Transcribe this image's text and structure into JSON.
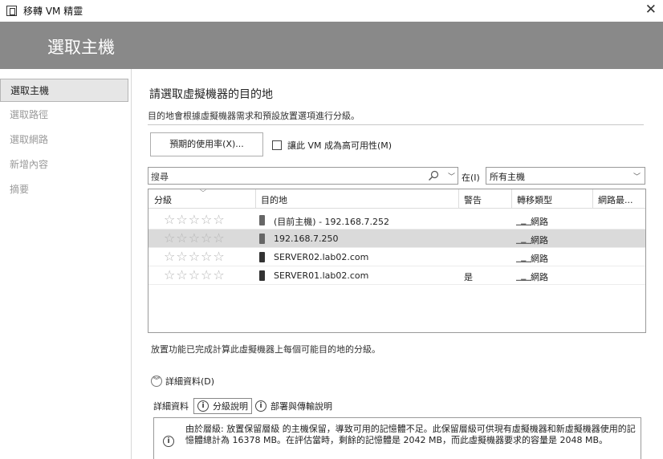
{
  "window": {
    "title": "移轉 VM 精靈",
    "close_glyph": "✕"
  },
  "banner": {
    "heading": "選取主機"
  },
  "sidebar": {
    "items": [
      {
        "label": "選取主機",
        "active": true
      },
      {
        "label": "選取路徑",
        "active": false
      },
      {
        "label": "選取網路",
        "active": false
      },
      {
        "label": "新增內容",
        "active": false
      },
      {
        "label": "摘要",
        "active": false
      }
    ]
  },
  "section": {
    "title": "請選取虛擬機器的目的地",
    "description": "目的地會根據虛擬機器需求和預設放置選項進行分級。"
  },
  "toolbar": {
    "usage_button": "預期的使用率(X)...",
    "ha_checkbox_label": "讓此 VM 成為高可用性(M)",
    "ha_checked": false
  },
  "search": {
    "placeholder": "搜尋",
    "in_label": "在(I)",
    "scope_value": "所有主機"
  },
  "grid": {
    "columns": [
      "分級",
      "目的地",
      "警告",
      "轉移類型",
      "網路最..."
    ],
    "rows": [
      {
        "stars": "☆☆☆☆☆",
        "destination": "(目前主機) - 192.168.7.252",
        "warning": "",
        "transfer": "網路",
        "network": "",
        "selected": false
      },
      {
        "stars": "☆☆☆☆☆",
        "destination": "192.168.7.250",
        "warning": "",
        "transfer": "網路",
        "network": "",
        "selected": true
      },
      {
        "stars": "☆☆☆☆☆",
        "destination": "SERVER02.lab02.com",
        "warning": "",
        "transfer": "網路",
        "network": "",
        "selected": false
      },
      {
        "stars": "☆☆☆☆☆",
        "destination": "SERVER01.lab02.com",
        "warning": "是",
        "transfer": "網路",
        "network": "",
        "selected": false
      }
    ]
  },
  "status": "放置功能已完成計算此虛擬機器上每個可能目的地的分級。",
  "details": {
    "toggle_label": "詳細資料(D)",
    "tabs_label": "詳細資料",
    "tabs": [
      {
        "label": "分級說明",
        "active": true
      },
      {
        "label": "部署與傳輸說明",
        "active": false
      }
    ],
    "info_glyph": "i",
    "message": "由於層級: 放置保留層級 的主機保留，導致可用的記憶體不足。此保留層級可供現有虛擬機器和新虛擬機器使用的記憶體總計為 16378 MB。在評估當時，剩餘的記憶體是 2042 MB，而此虛擬機器要求的容量是 2048 MB。"
  }
}
